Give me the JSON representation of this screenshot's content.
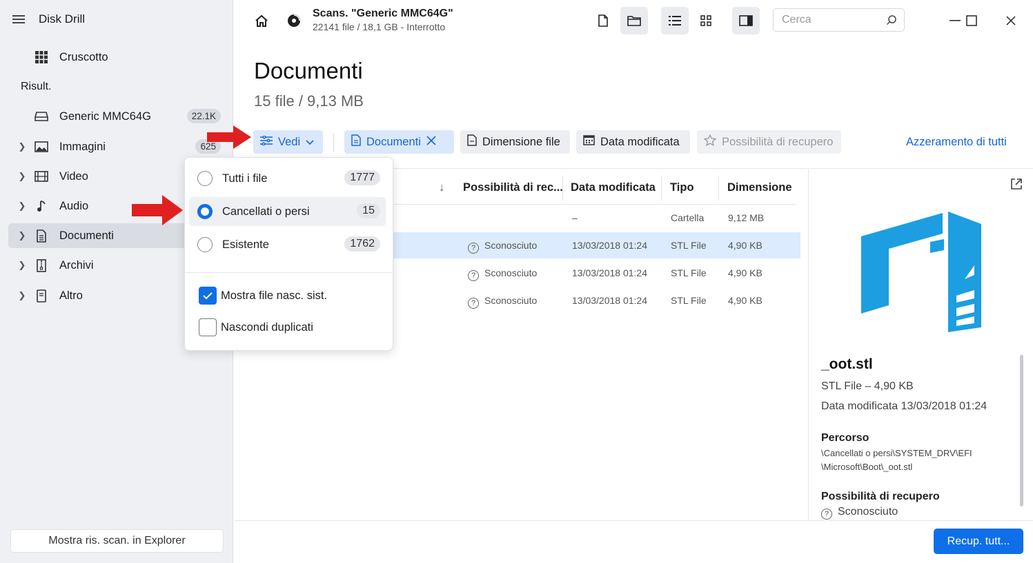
{
  "app": {
    "title": "Disk Drill"
  },
  "sidebar": {
    "dashboard_label": "Cruscotto",
    "section_label": "Risult.",
    "device": {
      "label": "Generic MMC64G",
      "badge": "22.1K"
    },
    "items": [
      {
        "label": "Immagini",
        "badge": "625",
        "icon": "image-icon"
      },
      {
        "label": "Video",
        "icon": "film-icon"
      },
      {
        "label": "Audio",
        "icon": "music-note-icon"
      },
      {
        "label": "Documenti",
        "icon": "document-icon",
        "active": true
      },
      {
        "label": "Archivi",
        "icon": "archive-icon"
      },
      {
        "label": "Altro",
        "icon": "file-icon"
      }
    ],
    "explorer_button": "Mostra ris. scan. in Explorer"
  },
  "topbar": {
    "scan_title": "Scans. \"Generic MMC64G\"",
    "scan_subtitle": "22141 file / 18,1 GB - Interrotto",
    "search_placeholder": "Cerca"
  },
  "main": {
    "title": "Documenti",
    "subtitle": "15 file / 9,13 MB"
  },
  "filters": {
    "view_label": "Vedi",
    "category_chip": "Documenti",
    "size_chip": "Dimensione file",
    "date_chip": "Data modificata",
    "recovery_chip": "Possibilità di recupero",
    "reset_all": "Azzeramento di tutti"
  },
  "table": {
    "sort_indicator": "↓",
    "columns": [
      "Possibilità di rec...",
      "Data modificata",
      "Tipo",
      "Dimensione"
    ],
    "rows": [
      {
        "recovery": "",
        "date": "–",
        "type": "Cartella",
        "size": "9,12 MB"
      },
      {
        "recovery": "Sconosciuto",
        "date": "13/03/2018 01:24",
        "type": "STL File",
        "size": "4,90 KB",
        "selected": true
      },
      {
        "recovery": "Sconosciuto",
        "date": "13/03/2018 01:24",
        "type": "STL File",
        "size": "4,90 KB"
      },
      {
        "recovery": "Sconosciuto",
        "date": "13/03/2018 01:24",
        "type": "STL File",
        "size": "4,90 KB"
      }
    ]
  },
  "dropdown": {
    "options": [
      {
        "label": "Tutti i file",
        "count": "1777",
        "selected": false
      },
      {
        "label": "Cancellati o persi",
        "count": "15",
        "selected": true
      },
      {
        "label": "Esistente",
        "count": "1762",
        "selected": false
      }
    ],
    "checks": [
      {
        "label": "Mostra file nasc. sist.",
        "checked": true
      },
      {
        "label": "Nascondi duplicati",
        "checked": false
      }
    ]
  },
  "preview": {
    "file_name": "_oot.stl",
    "type_size": "STL File – 4,90 KB",
    "modified": "Data modificata 13/03/2018 01:24",
    "path_label": "Percorso",
    "path_line1": "\\Cancellati o persi\\SYSTEM_DRV\\EFI",
    "path_line2": "\\Microsoft\\Boot\\_oot.stl",
    "recovery_label": "Possibilità di recupero",
    "recovery_value": "Sconosciuto"
  },
  "footer": {
    "recover_button": "Recup. tutt..."
  },
  "colors": {
    "accent": "#0f6fe8",
    "selected_row": "#dcebfd",
    "arrow": "#e02020",
    "logo": "#1c9ee0"
  }
}
